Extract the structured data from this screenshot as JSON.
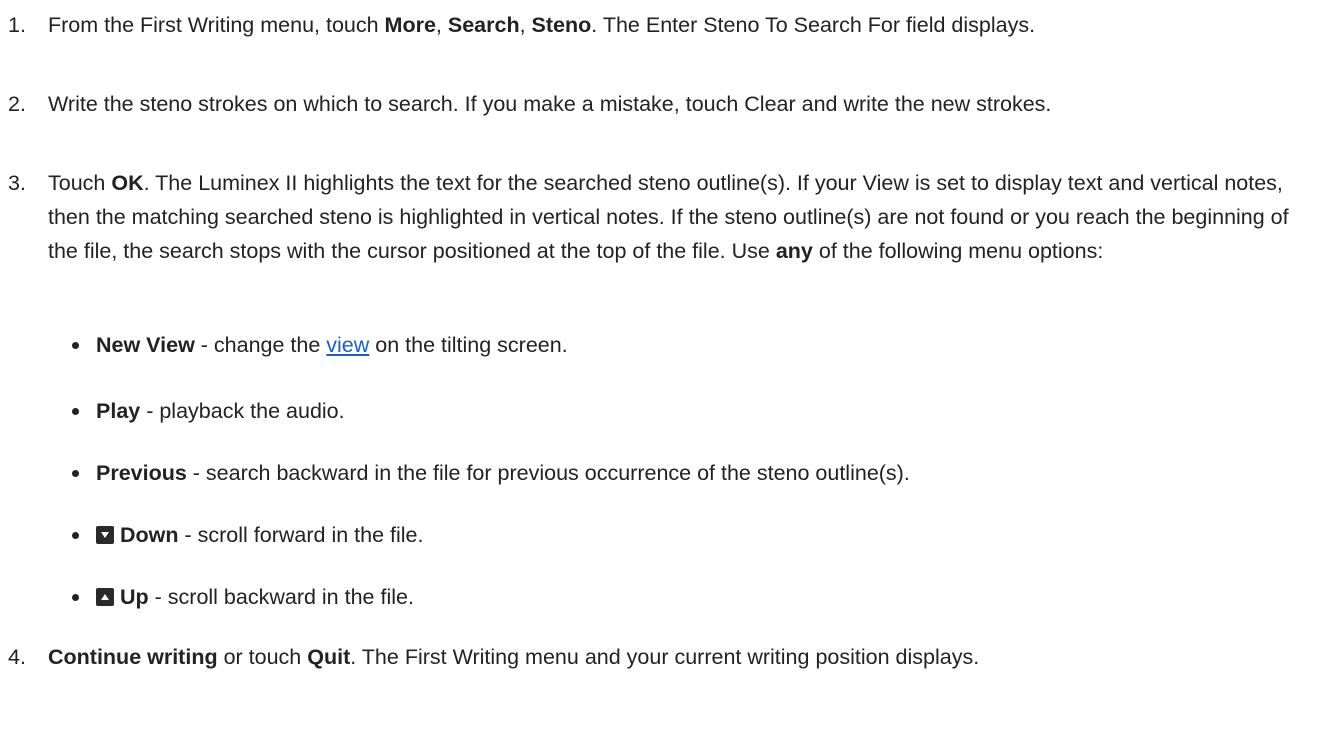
{
  "steps": [
    {
      "number": "1.",
      "parts": [
        {
          "t": "From the First Writing menu, touch "
        },
        {
          "b": "More"
        },
        {
          "t": ", "
        },
        {
          "b": "Search"
        },
        {
          "t": ", "
        },
        {
          "b": "Steno"
        },
        {
          "t": ". The Enter Steno To Search For field displays."
        }
      ]
    },
    {
      "number": "2.",
      "parts": [
        {
          "t": "Write the steno strokes on which to search. If you make a mistake, touch Clear and write the new strokes."
        }
      ]
    },
    {
      "number": "3.",
      "parts": [
        {
          "t": "Touch "
        },
        {
          "b": "OK"
        },
        {
          "t": ". The Luminex II highlights the text for the searched steno outline(s). If your View is set to display text and vertical notes, then the matching searched steno is highlighted in vertical notes. If the steno outline(s) are not found or you reach the beginning of the file, the search stops with the cursor positioned at the top of the file. Use "
        },
        {
          "b": "any"
        },
        {
          "t": " of the following menu options:"
        }
      ]
    },
    {
      "number": "4.",
      "parts": [
        {
          "b": "Continue writing"
        },
        {
          "t": " or touch "
        },
        {
          "b": "Quit"
        },
        {
          "t": ". The First Writing menu and your current writing position displays."
        }
      ]
    }
  ],
  "options": [
    {
      "icon": "",
      "label": "New View",
      "pre": " - change the ",
      "link": "view",
      "post": " on the tilting screen."
    },
    {
      "icon": "",
      "label": "Play",
      "pre": " - playback the audio.",
      "link": "",
      "post": ""
    },
    {
      "icon": "",
      "label": "Previous",
      "pre": " - search backward in the file for previous occurrence of the steno outline(s).",
      "link": "",
      "post": ""
    },
    {
      "icon": "down-arrow-key-icon",
      "label": "Down",
      "pre": " - scroll forward in the file.",
      "link": "",
      "post": ""
    },
    {
      "icon": "up-arrow-key-icon",
      "label": "Up",
      "pre": " - scroll backward in the file.",
      "link": "",
      "post": ""
    }
  ],
  "colors": {
    "text": "#222222",
    "link": "#1a5fd1",
    "icon_bg": "#2a2a2a"
  }
}
